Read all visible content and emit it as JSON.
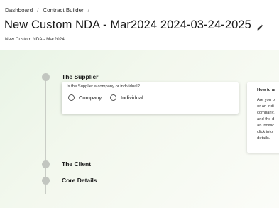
{
  "breadcrumb": {
    "items": [
      "Dashboard",
      "Contract Builder"
    ],
    "separator": "/"
  },
  "header": {
    "title": "New Custom NDA - Mar2024 2024-03-24-2025",
    "subtitle": "New Custom NDA - Mar2024",
    "edit_icon": "pencil-icon"
  },
  "steps": [
    {
      "label": "The Supplier",
      "state": "active"
    },
    {
      "label": "The Client",
      "state": "pending"
    },
    {
      "label": "Core Details",
      "state": "pending"
    }
  ],
  "supplier_question": {
    "question": "Is the Supplier a company or individual?",
    "options": [
      "Company",
      "Individual"
    ],
    "selected": null
  },
  "help_panel": {
    "title": "How to ar",
    "lines": [
      "Are you p",
      "or an indi",
      "company,",
      "and the d",
      "an indivic",
      "click into",
      "details."
    ]
  },
  "colors": {
    "background_tint": "#eaf4e6",
    "step_dot": "#c2c6c0",
    "timeline": "#c9cdc6"
  }
}
